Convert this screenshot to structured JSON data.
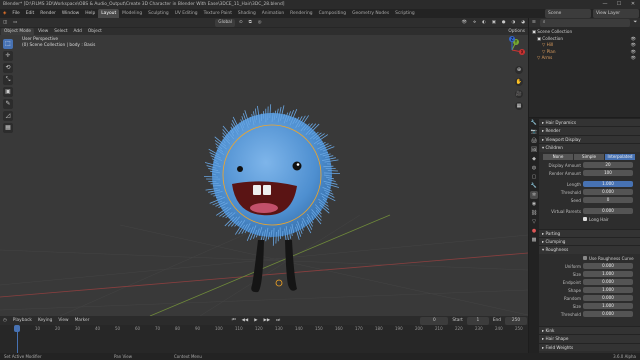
{
  "window": {
    "title": "Blender* [D:\\FILMS 3D\\Workspace\\OBS & Audio_Output\\Create 3D Character in Blender With Ease\\3DCE_11_Hair\\3DC_28.blend]",
    "controls": [
      "—",
      "☐",
      "✕"
    ]
  },
  "menubar": {
    "logo": "◈",
    "menus": [
      "File",
      "Edit",
      "Render",
      "Window",
      "Help"
    ],
    "workspaces": [
      "Layout",
      "Modeling",
      "Sculpting",
      "UV Editing",
      "Texture Paint",
      "Shading",
      "Animation",
      "Rendering",
      "Compositing",
      "Geometry Nodes",
      "Scripting"
    ],
    "active_workspace": "Layout",
    "scene": "Scene",
    "view_layer": "View Layer"
  },
  "viewport_header": {
    "mode": "Object Mode",
    "menus": [
      "View",
      "Select",
      "Add",
      "Object"
    ],
    "orientation": "Global",
    "options": "Options"
  },
  "viewport": {
    "info_line1": "User Perspective",
    "info_line2": "(0) Scene Collection | body : Basis"
  },
  "toolbar": {
    "tools": [
      "⬚",
      "✛",
      "⟲",
      "⤡",
      "▣",
      "✎",
      "◿",
      "▦"
    ]
  },
  "nav": {
    "axes": [
      "X",
      "Y",
      "Z"
    ],
    "buttons": [
      "⊕",
      "✋",
      "🎥",
      "▦"
    ]
  },
  "timeline": {
    "menus": [
      "Playback",
      "Keying",
      "View",
      "Marker"
    ],
    "current_frame": "0",
    "start_label": "Start",
    "start": "1",
    "end_label": "End",
    "end": "250",
    "ticks": [
      "0",
      "10",
      "20",
      "30",
      "40",
      "50",
      "60",
      "70",
      "80",
      "90",
      "100",
      "110",
      "120",
      "130",
      "140",
      "150",
      "160",
      "170",
      "180",
      "190",
      "200",
      "210",
      "220",
      "230",
      "240",
      "250"
    ]
  },
  "statusbar": {
    "left": "Set Active Modifier",
    "mid1": "Pan View",
    "mid2": "Context Menu",
    "version": "3.6.0 Alpha"
  },
  "outliner": {
    "title": "Scene Collection",
    "items": [
      {
        "label": "Scene Collection",
        "indent": 0
      },
      {
        "label": "Collection",
        "indent": 1
      },
      {
        "label": "Hill",
        "indent": 2
      },
      {
        "label": "Plan",
        "indent": 2
      },
      {
        "label": "Arms",
        "indent": 1
      }
    ]
  },
  "properties": {
    "panels_top": [
      "Hair Dynamics",
      "Render",
      "Viewport Display",
      "Children"
    ],
    "children_modes": [
      "None",
      "Simple",
      "Interpolated"
    ],
    "active_mode": "Interpolated",
    "fields_a": [
      {
        "label": "Display Amount",
        "value": "20"
      },
      {
        "label": "Render Amount",
        "value": "100"
      }
    ],
    "fields_b": [
      {
        "label": "Length",
        "value": "1.000",
        "blue": true
      },
      {
        "label": "Threshold",
        "value": "0.000"
      },
      {
        "label": "Seed",
        "value": "0"
      }
    ],
    "virtual_parents": {
      "label": "Virtual Parents",
      "value": "0.000"
    },
    "long_hair": "Long Hair",
    "panels_mid": [
      "Parting",
      "Clumping",
      "Roughness"
    ],
    "use_curve": "Use Roughness Curve",
    "rough_fields": [
      {
        "label": "Uniform",
        "value": "0.000"
      },
      {
        "label": "Size",
        "value": "1.000"
      },
      {
        "label": "Endpoint",
        "value": "0.000"
      },
      {
        "label": "Shape",
        "value": "1.000"
      },
      {
        "label": "Random",
        "value": "0.000"
      },
      {
        "label": "Size",
        "value": "1.000"
      },
      {
        "label": "Threshold",
        "value": "0.000"
      }
    ],
    "panels_bottom": [
      "Kink",
      "Hair Shape",
      "Field Weights"
    ]
  },
  "colors": {
    "accent": "#4772b3",
    "fur": "#5b9bd9",
    "outline": "#f5a623"
  }
}
